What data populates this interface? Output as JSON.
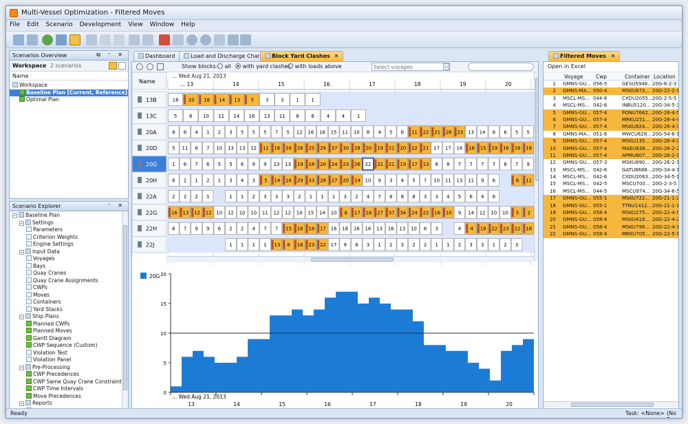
{
  "window": {
    "title": "Multi-Vessel Optimization - Filtered Moves"
  },
  "menu": [
    "File",
    "Edit",
    "Scenario",
    "Development",
    "View",
    "Window",
    "Help"
  ],
  "scenarios": {
    "title": "Scenarios Overview",
    "workspace_label": "Workspace",
    "workspace_count": "2 scenarios",
    "col_name": "Name",
    "items": [
      {
        "label": "Workspace",
        "level": 0,
        "selected": false
      },
      {
        "label": "Baseline Plan [Current, Reference]",
        "level": 1,
        "selected": true
      },
      {
        "label": "Optimal Plan",
        "level": 1,
        "selected": false
      }
    ]
  },
  "explorer": {
    "title": "Scenario Explorer",
    "items": [
      {
        "label": "Baseline Plan",
        "level": 0,
        "kind": "root"
      },
      {
        "label": "Settings",
        "level": 1,
        "kind": "folder"
      },
      {
        "label": "Parameters",
        "level": 2,
        "kind": "doc"
      },
      {
        "label": "Criterion Weights",
        "level": 2,
        "kind": "doc"
      },
      {
        "label": "Engine Settings",
        "level": 2,
        "kind": "doc"
      },
      {
        "label": "Input Data",
        "level": 1,
        "kind": "folder"
      },
      {
        "label": "Voyages",
        "level": 2,
        "kind": "doc"
      },
      {
        "label": "Bays",
        "level": 2,
        "kind": "doc"
      },
      {
        "label": "Quay Cranes",
        "level": 2,
        "kind": "doc"
      },
      {
        "label": "Quay Crane Assignments",
        "level": 2,
        "kind": "doc"
      },
      {
        "label": "CWPs",
        "level": 2,
        "kind": "doc"
      },
      {
        "label": "Moves",
        "level": 2,
        "kind": "doc"
      },
      {
        "label": "Containers",
        "level": 2,
        "kind": "doc"
      },
      {
        "label": "Yard Stacks",
        "level": 2,
        "kind": "doc"
      },
      {
        "label": "Ship Plans",
        "level": 1,
        "kind": "folder"
      },
      {
        "label": "Planned CWPs",
        "level": 2,
        "kind": "green"
      },
      {
        "label": "Planned Moves",
        "level": 2,
        "kind": "green"
      },
      {
        "label": "Gantt Diagram",
        "level": 2,
        "kind": "green"
      },
      {
        "label": "CWP Sequence (Custom)",
        "level": 2,
        "kind": "green"
      },
      {
        "label": "Violation Test",
        "level": 2,
        "kind": "doc"
      },
      {
        "label": "Violation Panel",
        "level": 2,
        "kind": "doc"
      },
      {
        "label": "Pre-Processing",
        "level": 1,
        "kind": "folder"
      },
      {
        "label": "CWP Precedences",
        "level": 2,
        "kind": "green"
      },
      {
        "label": "CWP Same Quay Crane Constraints",
        "level": 2,
        "kind": "green"
      },
      {
        "label": "CWP Time Intervals",
        "level": 2,
        "kind": "green"
      },
      {
        "label": "Move Precedences",
        "level": 2,
        "kind": "green"
      },
      {
        "label": "Reports",
        "level": 1,
        "kind": "folder"
      },
      {
        "label": "Dashboard",
        "level": 2,
        "kind": "doc"
      }
    ]
  },
  "tabs": [
    {
      "label": "Dashboard",
      "active": false
    },
    {
      "label": "Load and Discharge Chart",
      "active": false
    },
    {
      "label": "Block Yard Clashes",
      "active": true
    }
  ],
  "clashes": {
    "show_blocks_label": "Show blocks:",
    "options": [
      "all",
      "with yard clashes",
      "with loads above"
    ],
    "selected_option": "with yard clashes",
    "voyage_placeholder": "Select voyages",
    "date_label": "Wed Aug 21, 2013",
    "name_header": "Name",
    "blocks_header": "Blocks",
    "hours": [
      "... 13",
      "14",
      "15",
      "16",
      "17",
      "18",
      "19",
      "20",
      "21"
    ],
    "rows": [
      {
        "name": "13B",
        "cells": [
          "18",
          "o:20",
          "o:18",
          "o:14",
          "o:13",
          "o:5",
          "3",
          "3",
          "1",
          "1",
          "",
          "",
          "",
          "",
          "",
          "",
          "",
          "",
          "",
          "",
          "",
          "",
          "",
          ""
        ]
      },
      {
        "name": "13C",
        "cells": [
          "5",
          "6",
          "10",
          "11",
          "14",
          "16",
          "13",
          "11",
          "8",
          "6",
          "4",
          "4",
          "1",
          "",
          "",
          "",
          "",
          "",
          "",
          "",
          "",
          "",
          "",
          ""
        ]
      },
      {
        "name": "20A",
        "cells": [
          "8",
          "6",
          "4",
          "1",
          "2",
          "3",
          "5",
          "5",
          "5",
          "7",
          "5",
          "12",
          "16",
          "16",
          "15",
          "11",
          "10",
          "8",
          "4",
          "5",
          "6",
          "o:11",
          "o:22",
          "o:21",
          "o:26",
          "o:23",
          "13",
          "14",
          "8",
          "6",
          "5",
          "5"
        ]
      },
      {
        "name": "20D",
        "cells": [
          "5",
          "11",
          "8",
          "7",
          "10",
          "13",
          "13",
          "12",
          "o:11",
          "o:16",
          "o:16",
          "o:26",
          "o:25",
          "o:29",
          "o:37",
          "o:30",
          "o:28",
          "o:20",
          "o:19",
          "o:21",
          "o:20",
          "o:22",
          "o:21",
          "17",
          "17",
          "16",
          "o:18",
          "o:15",
          "o:19",
          "o:16",
          "o:16",
          "o:18"
        ]
      },
      {
        "name": "20G",
        "cells": [
          "1",
          "6",
          "7",
          "6",
          "5",
          "5",
          "6",
          "9",
          "9",
          "13",
          "13",
          "o:19",
          "o:18",
          "o:20",
          "o:24",
          "o:23",
          "o:26",
          "b:22",
          "o:22",
          "o:21",
          "o:19",
          "o:17",
          "o:13",
          "8",
          "8",
          "7",
          "7",
          "7",
          "7",
          "8",
          "7",
          "9"
        ]
      },
      {
        "name": "20H",
        "cells": [
          "6",
          "2",
          "1",
          "2",
          "1",
          "3",
          "4",
          "3",
          "o:5",
          "o:14",
          "o:16",
          "o:29",
          "o:33",
          "o:28",
          "o:27",
          "o:20",
          "o:14",
          "10",
          "9",
          "3",
          "4",
          "5",
          "7",
          "10",
          "11",
          "13",
          "11",
          "9",
          "6",
          "",
          "o:6",
          "o:11"
        ]
      },
      {
        "name": "22A",
        "cells": [
          "2",
          "2",
          "2",
          "1",
          "",
          "1",
          "1",
          "2",
          "3",
          "3",
          "3",
          "2",
          "1",
          "1",
          "1",
          "3",
          "2",
          "4",
          "7",
          "8",
          "8",
          "8",
          "3",
          "3",
          "4",
          "5",
          "6",
          "4",
          "6",
          "",
          "",
          ""
        ]
      },
      {
        "name": "22G",
        "cells": [
          "o:16",
          "o:13",
          "o:12",
          "o:12",
          "10",
          "12",
          "10",
          "10",
          "11",
          "12",
          "12",
          "14",
          "15",
          "14",
          "10",
          "o:8",
          "o:17",
          "o:18",
          "o:27",
          "o:37",
          "o:34",
          "o:24",
          "o:22",
          "o:16",
          "o:10",
          "9",
          "14",
          "12",
          "10",
          "10",
          "o:5",
          "o:2"
        ]
      },
      {
        "name": "22H",
        "cells": [
          "6",
          "7",
          "9",
          "9",
          "6",
          "2",
          "2",
          "4",
          "7",
          "7",
          "o:15",
          "o:16",
          "o:18",
          "o:17",
          "16",
          "18",
          "16",
          "16",
          "13",
          "16",
          "13",
          "10",
          "6",
          "3",
          "",
          "4",
          "o:4",
          "o:18",
          "o:22",
          "o:23",
          "o:22",
          "o:18"
        ]
      },
      {
        "name": "22J",
        "cells": [
          "",
          "",
          "",
          "",
          "",
          "1",
          "1",
          "1",
          "1",
          "o:13",
          "o:6",
          "o:16",
          "o:23",
          "o:22",
          "17",
          "9",
          "8",
          "3",
          "1",
          "2",
          "3",
          "2",
          "2",
          "1",
          "1",
          "2",
          "3",
          "3",
          "1",
          "2",
          "3",
          ""
        ]
      }
    ]
  },
  "chart_data": {
    "type": "area",
    "series_name": "20G",
    "y_ticks": [
      "0",
      "5",
      "10",
      "15",
      "20"
    ],
    "ylim": [
      0,
      20
    ],
    "x_labels": [
      "13",
      "14",
      "15",
      "16",
      "17",
      "18",
      "19",
      "20",
      "21"
    ],
    "date_label": "Wed Aug 21, 2013",
    "values": [
      1,
      6,
      7,
      6,
      5,
      5,
      6,
      9,
      9,
      13,
      13,
      14,
      13,
      14,
      16,
      17,
      17,
      15,
      16,
      15,
      14,
      14,
      12,
      8,
      8,
      7,
      7,
      5,
      4,
      2,
      7,
      8,
      9
    ]
  },
  "filtered_moves": {
    "title": "Filtered Moves",
    "open_excel": "Open in Excel",
    "columns": [
      "Voyage",
      "Cwp",
      "Container",
      "Location"
    ],
    "rows": [
      {
        "n": "1",
        "voyage": "GMNS-GU...",
        "cwp": "056-5",
        "container": "GESU5948...",
        "location": "20G-6-2-3",
        "hl": false
      },
      {
        "n": "2",
        "voyage": "GMNS-MA...",
        "cwp": "050-4",
        "container": "MSKU873...",
        "location": "20G-22-2-1",
        "hl": true
      },
      {
        "n": "3",
        "voyage": "MSCL-MS...",
        "cwp": "044-6",
        "container": "CXDU2055...",
        "location": "20G-2-5-5",
        "hl": false
      },
      {
        "n": "4",
        "voyage": "MSCL-MS...",
        "cwp": "042-6",
        "container": "INBU5120...",
        "location": "20G-34-5-3",
        "hl": false
      },
      {
        "n": "5",
        "voyage": "GMNS-GU...",
        "cwp": "057-4",
        "container": "PONU7662...",
        "location": "20G-26-4-5",
        "hl": true
      },
      {
        "n": "6",
        "voyage": "GMNS-GU...",
        "cwp": "057-4",
        "container": "MRKU251...",
        "location": "20G-26-4-4",
        "hl": true
      },
      {
        "n": "7",
        "voyage": "GMNS-GU...",
        "cwp": "057-4",
        "container": "MSKU824...",
        "location": "20G-26-4-3",
        "hl": true
      },
      {
        "n": "8",
        "voyage": "GMNS-MA...",
        "cwp": "051-6",
        "container": "MWCU628...",
        "location": "20G-54-6-1",
        "hl": false
      },
      {
        "n": "9",
        "voyage": "GMNS-GU...",
        "cwp": "057-4",
        "container": "MSKU135...",
        "location": "20G-26-4-2",
        "hl": true
      },
      {
        "n": "10",
        "voyage": "GMNS-GU...",
        "cwp": "057-4",
        "container": "MAEU838...",
        "location": "20G-26-2-2",
        "hl": true
      },
      {
        "n": "11",
        "voyage": "GMNS-GU...",
        "cwp": "057-4",
        "container": "APMU807...",
        "location": "20G-26-2-1",
        "hl": true
      },
      {
        "n": "12",
        "voyage": "GMNS-GU...",
        "cwp": "057-3",
        "container": "MSKU890...",
        "location": "20G-26-2-1",
        "hl": false
      },
      {
        "n": "13",
        "voyage": "MSCL-MS...",
        "cwp": "042-6",
        "container": "GATU8688...",
        "location": "20G-34-4-1",
        "hl": false
      },
      {
        "n": "14",
        "voyage": "MSCL-MS...",
        "cwp": "042-6",
        "container": "CXDU2063...",
        "location": "20G-34-5-1",
        "hl": false
      },
      {
        "n": "15",
        "voyage": "MSCL-MS...",
        "cwp": "042-5",
        "container": "MSCU700...",
        "location": "20G-2-3-5",
        "hl": false
      },
      {
        "n": "16",
        "voyage": "MSCL-MS...",
        "cwp": "044-5",
        "container": "MSCU974...",
        "location": "20G-34-6-5",
        "hl": false
      },
      {
        "n": "17",
        "voyage": "GMNS-GU...",
        "cwp": "055-1",
        "container": "MSKU722...",
        "location": "20G-21-1-2",
        "hl": true
      },
      {
        "n": "18",
        "voyage": "GMNS-GU...",
        "cwp": "055-1",
        "container": "TTNU1412...",
        "location": "20G-21-1-1",
        "hl": true
      },
      {
        "n": "19",
        "voyage": "GMNS-GU...",
        "cwp": "058-4",
        "container": "MSKU275...",
        "location": "20G-22-4-5",
        "hl": true
      },
      {
        "n": "20",
        "voyage": "GMNS-GU...",
        "cwp": "058-4",
        "container": "MSKU418...",
        "location": "20G-22-4-2",
        "hl": true
      },
      {
        "n": "21",
        "voyage": "GMNS-GU...",
        "cwp": "058-4",
        "container": "MSKU798...",
        "location": "20G-22-4-1",
        "hl": true
      },
      {
        "n": "22",
        "voyage": "GMNS-GU...",
        "cwp": "058-4",
        "container": "MRKU705...",
        "location": "20G-22-5-1",
        "hl": true
      }
    ]
  },
  "status": {
    "left": "Ready",
    "task": "Task: <None>",
    "right": "(No Re"
  },
  "colors": {
    "accent": "#3b7fdb",
    "clash": "#f6b73c",
    "chart_fill": "#1c7cd5"
  }
}
